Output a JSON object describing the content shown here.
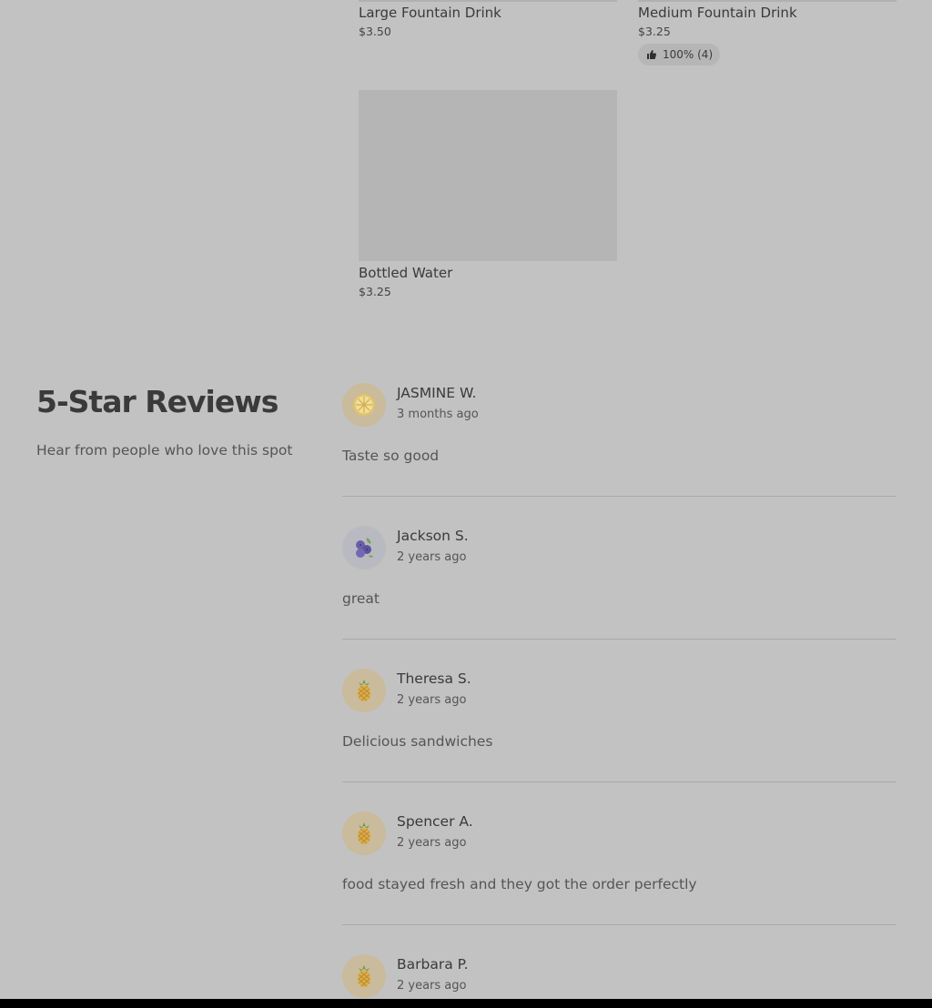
{
  "menu": {
    "items": [
      {
        "name": "Large Fountain Drink",
        "price": "$3.50"
      },
      {
        "name": "Medium Fountain Drink",
        "price": "$3.25",
        "rating": "100% (4)",
        "rating_icon": "thumbs-up-icon"
      },
      {
        "name": "Bottled Water",
        "price": "$3.25"
      }
    ]
  },
  "reviews": {
    "title": "5-Star Reviews",
    "subtitle": "Hear from people who love this spot",
    "list": [
      {
        "name": "JASMINE W.",
        "time": "3 months ago",
        "text": "Taste so good",
        "avatar_icon": "lemon-icon"
      },
      {
        "name": "Jackson S.",
        "time": "2 years ago",
        "text": "great",
        "avatar_icon": "blueberries-icon"
      },
      {
        "name": "Theresa S.",
        "time": "2 years ago",
        "text": "Delicious sandwiches",
        "avatar_icon": "pineapple-icon"
      },
      {
        "name": "Spencer A.",
        "time": "2 years ago",
        "text": "food stayed fresh and they got the order perfectly",
        "avatar_icon": "pineapple-icon"
      },
      {
        "name": "Barbara P.",
        "time": "2 years ago",
        "text": "",
        "avatar_icon": "pineapple-icon"
      }
    ]
  },
  "colors": {
    "background": "#c2c2c2",
    "avatar_bg": "#c9bb9c",
    "text_primary": "#3a3a3a"
  }
}
